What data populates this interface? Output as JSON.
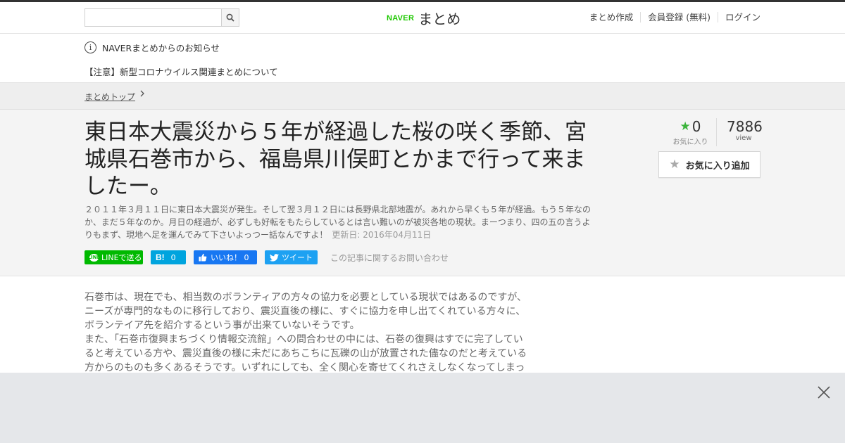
{
  "header": {
    "search_placeholder": "",
    "logo_naver": "NAVER",
    "logo_matome": "まとめ",
    "nav": [
      "まとめ作成",
      "会員登録 (無料)",
      "ログイン"
    ]
  },
  "notice": {
    "heading": "NAVERまとめからのお知らせ",
    "link": "【注意】新型コロナウイルス関連まとめについて"
  },
  "breadcrumb": {
    "top": "まとめトップ"
  },
  "article": {
    "title": "東日本大震災から５年が経過した桜の咲く季節、宮城県石巻市から、福島県川俣町とかまで行って来ましたー。",
    "description": "２０１１年３月１１日に東日本大震災が発生。そして翌３月１２日には長野県北部地震が。あれから早くも５年が経過。もう５年なのか、まだ５年なのか。月日の経過が、必ずしも好転をもたらしているとは言い難いのが被災各地の現状。まーつまり、四の五の言うよりもまず、現地へ足を運んでみて下さいよっつー話なんですよ！",
    "updated": "更新日: 2016年04月11日",
    "favorites_count": "0",
    "favorites_label": "お気に入り",
    "views_count": "7886",
    "views_label": "view",
    "fav_button": "お気に入り追加"
  },
  "share": {
    "line": "LINEで送る",
    "hatena_icon": "B!",
    "hatena_count": "0",
    "like": "いいね！ 0",
    "tweet": "ツイート",
    "contact": "この記事に関するお問い合わせ"
  },
  "body": {
    "paragraphs": [
      "石巻市は、現在でも、相当数のボランティアの方々の協力を必要としている現状ではあるのですが、ニーズが専門的なものに移行しており、震災直後の様に、すぐに協力を申し出てくれている方々に、ボランテイア先を紹介するという事が出来ていないそうです。",
      "また、「石巻市復興まちづくり情報交流館」への問合わせの中には、石巻の復興はすでに完了していると考えている方や、震災直後の様に未だにあちこちに瓦礫の山が放置された儘なのだと考えている方からのものも多くあるそうです。いずれにしても、全く関心を寄せてくれさえしなくなってしまっ"
    ]
  },
  "colors": {
    "naver_green": "#1ec800",
    "line_green": "#00b900",
    "hatena_blue": "#00a4de",
    "facebook_blue": "#1877f2",
    "twitter_blue": "#1da1f2",
    "star_green": "#3cb43c"
  },
  "icons": [
    "search-icon",
    "info-icon",
    "chevron-right-icon",
    "star-icon",
    "line-icon",
    "hatena-icon",
    "like-thumb-icon",
    "twitter-bird-icon",
    "close-icon"
  ]
}
